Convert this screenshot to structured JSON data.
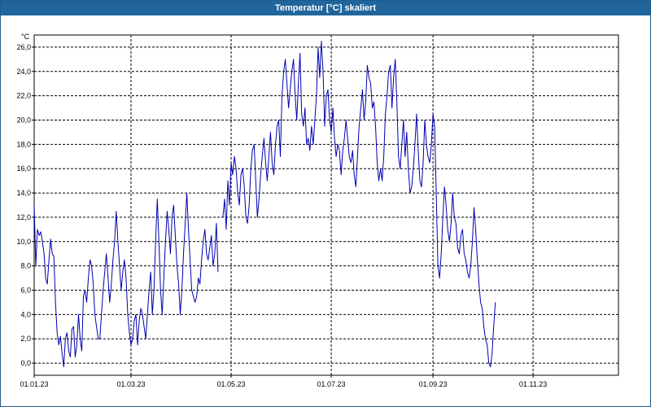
{
  "window": {
    "title": "Temperatur [°C] skaliert"
  },
  "chart_data": {
    "type": "line",
    "title": "Temperatur [°C] skaliert",
    "ylabel": "°C",
    "xlabel": "",
    "ylim": [
      -1,
      27
    ],
    "xlim": [
      "2023-01-01",
      "2023-12-23"
    ],
    "grid": true,
    "y_ticks": [
      "0,0",
      "2,0",
      "4,0",
      "6,0",
      "8,0",
      "10,0",
      "12,0",
      "14,0",
      "16,0",
      "18,0",
      "20,0",
      "22,0",
      "24,0",
      "26,0"
    ],
    "x_ticks": [
      "01.01.23",
      "01.03.23",
      "01.05.23",
      "01.07.23",
      "01.09.23",
      "01.11.23"
    ],
    "series": [
      {
        "color": "#0000b0",
        "segments": [
          {
            "start": "2023-01-01",
            "values": [
              13.0,
              8.0,
              11.0,
              10.5,
              10.8,
              10.0,
              9.0,
              7.0,
              6.5,
              8.5,
              10.2,
              9.0,
              8.8,
              5.0,
              2.5,
              1.5,
              2.2,
              0.8,
              -0.3,
              2.0,
              2.5,
              1.0,
              0.5,
              2.8,
              3.0,
              0.5,
              1.5,
              4.0,
              2.0,
              1.0,
              5.5,
              6.0,
              5.0,
              7.0,
              8.5,
              8.0,
              6.5,
              4.0,
              3.0,
              2.0,
              2.0,
              4.0,
              6.0,
              7.5,
              9.0,
              7.0,
              5.0,
              6.5,
              8.5,
              10.0,
              12.5,
              10.0,
              8.0,
              6.0,
              7.5,
              8.5,
              7.0,
              4.0,
              2.5,
              1.5,
              2.0,
              3.5,
              4.0,
              1.5,
              3.5,
              4.5,
              4.0,
              3.0,
              2.0,
              4.0,
              6.0,
              7.5,
              4.0,
              6.0,
              10.0,
              13.5,
              10.0,
              6.0,
              4.0,
              7.0,
              10.0,
              12.5,
              11.0,
              9.0,
              12.0,
              13.0,
              10.5,
              8.0,
              6.5,
              4.0,
              6.0,
              9.0,
              11.5,
              14.0,
              11.0,
              8.5,
              6.0,
              5.5,
              5.0,
              5.5,
              7.0,
              6.5,
              8.5,
              10.0,
              11.0,
              9.0,
              8.5,
              9.5,
              10.5,
              8.0,
              9.0,
              11.5,
              7.5
            ]
          },
          {
            "start": "2023-04-26",
            "values": [
              12.0,
              13.5,
              11.0,
              15.0,
              13.0,
              16.5,
              15.5,
              17.0,
              16.0,
              14.0,
              13.0,
              15.5,
              16.0,
              14.5,
              12.0,
              11.5,
              13.0,
              16.0,
              17.5,
              18.0,
              15.0,
              12.0,
              13.5,
              15.5,
              17.0,
              18.5,
              16.5,
              15.0,
              17.0,
              19.0,
              16.5,
              15.5,
              18.0,
              19.5,
              20.0,
              17.0,
              22.0,
              24.0,
              25.0,
              23.0,
              21.0,
              22.5,
              24.0,
              25.0,
              22.0,
              20.0,
              23.0,
              25.5,
              20.5,
              19.5,
              21.0,
              18.0,
              18.5,
              17.5,
              19.5,
              18.0,
              20.0,
              22.0,
              26.0,
              23.5,
              26.5,
              24.0,
              19.5,
              22.0,
              22.5,
              20.0,
              19.0,
              21.0,
              18.5,
              17.0,
              18.0,
              17.5,
              15.5,
              17.5,
              18.5,
              20.0,
              18.5,
              17.0,
              16.5,
              17.5,
              15.5,
              14.5,
              17.0,
              19.5,
              21.0,
              22.5,
              20.0,
              21.5,
              24.5,
              23.5,
              23.0,
              21.0,
              21.5,
              19.5,
              16.5,
              15.0,
              16.0,
              15.0,
              17.0,
              20.5,
              22.0,
              24.0,
              24.5,
              21.0,
              23.5,
              25.0,
              21.5,
              17.0,
              16.0,
              18.0,
              20.0,
              17.0,
              19.0,
              16.0,
              14.0,
              14.5,
              16.0,
              18.0,
              20.5,
              17.5,
              15.0,
              14.5,
              16.5,
              20.0,
              18.0,
              17.0,
              16.5,
              18.0,
              20.5,
              19.5,
              14.0,
              8.0,
              7.0,
              9.0,
              12.0,
              14.5,
              13.0,
              11.0,
              10.0,
              11.5,
              14.0,
              12.0,
              11.5,
              9.5,
              9.0,
              10.5,
              11.0,
              9.0,
              8.5,
              7.5,
              7.0,
              8.0,
              10.0,
              12.8,
              11.0,
              8.5,
              6.5,
              5.0,
              4.5,
              3.0,
              2.0,
              1.5,
              0.0,
              -0.3,
              0.8,
              3.0,
              5.0
            ]
          }
        ]
      }
    ]
  }
}
